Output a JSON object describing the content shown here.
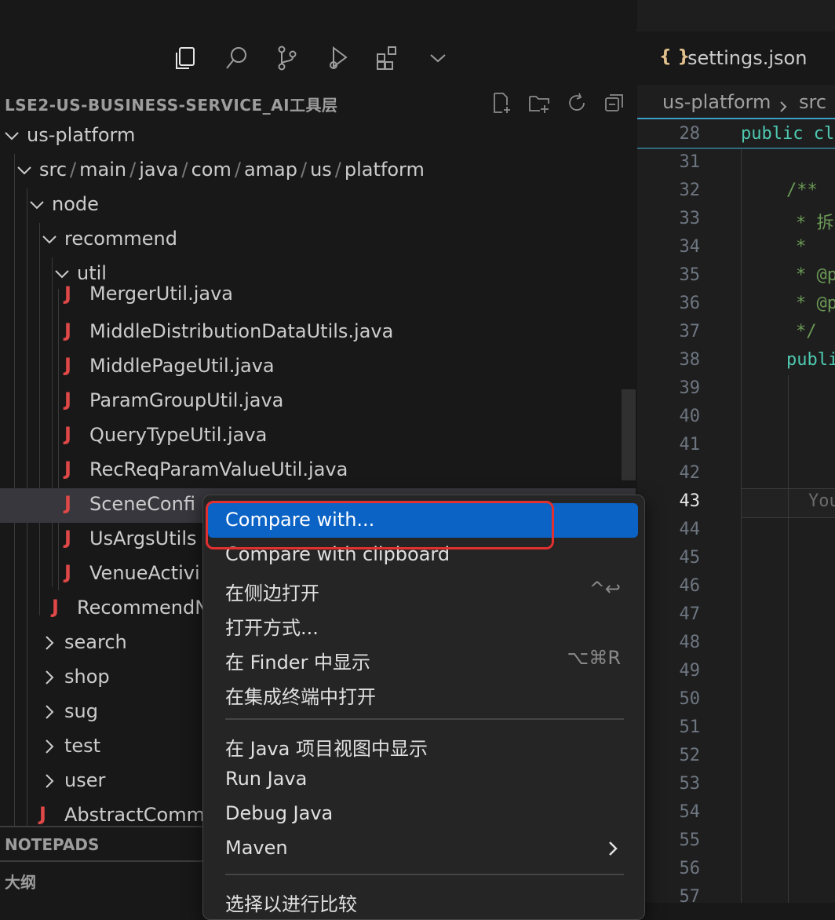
{
  "explorer": {
    "title": "LSE2-US-BUSINESS-SERVICE_AI工具层",
    "tree": {
      "root": "us-platform",
      "package_path": [
        "src",
        "main",
        "java",
        "com",
        "amap",
        "us",
        "platform"
      ],
      "node": "node",
      "recommend": "recommend",
      "util": "util",
      "util_files": [
        "MergerUtil.java",
        "MiddleDistributionDataUtils.java",
        "MiddlePageUtil.java",
        "ParamGroupUtil.java",
        "QueryTypeUtil.java",
        "RecReqParamValueUtil.java",
        "SceneConfi",
        "UsArgsUtils",
        "VenueActivi"
      ],
      "recommend_file": "RecommendN",
      "folders": [
        "search",
        "shop",
        "sug",
        "test",
        "user"
      ],
      "last_file": "AbstractComm",
      "java_icon": "J"
    },
    "sections": {
      "notepads": "NOTEPADS",
      "outline": "大纲"
    }
  },
  "editor": {
    "tab": {
      "icon": "{ }",
      "label": "settings.json"
    },
    "breadcrumbs": [
      "us-platform",
      "src"
    ],
    "lines": [
      {
        "num": "28",
        "text": "public cl"
      },
      {
        "num": "31",
        "text": ""
      },
      {
        "num": "32",
        "text": "/**"
      },
      {
        "num": "33",
        "text": "* 拆"
      },
      {
        "num": "34",
        "text": "*"
      },
      {
        "num": "35",
        "text": "* @p"
      },
      {
        "num": "36",
        "text": "* @p"
      },
      {
        "num": "37",
        "text": "*/"
      },
      {
        "num": "38",
        "text": "publi"
      },
      {
        "num": "39",
        "text": ""
      },
      {
        "num": "40",
        "text": ""
      },
      {
        "num": "41",
        "text": ""
      },
      {
        "num": "42",
        "text": ""
      },
      {
        "num": "43",
        "text": "You"
      },
      {
        "num": "44",
        "text": ""
      },
      {
        "num": "45",
        "text": ""
      },
      {
        "num": "46",
        "text": ""
      },
      {
        "num": "47",
        "text": ""
      },
      {
        "num": "48",
        "text": ""
      },
      {
        "num": "49",
        "text": ""
      },
      {
        "num": "50",
        "text": ""
      },
      {
        "num": "51",
        "text": ""
      },
      {
        "num": "52",
        "text": ""
      },
      {
        "num": "53",
        "text": ""
      },
      {
        "num": "54",
        "text": ""
      },
      {
        "num": "55",
        "text": ""
      },
      {
        "num": "56",
        "text": ""
      },
      {
        "num": "57",
        "text": ""
      }
    ]
  },
  "context_menu": {
    "items": [
      {
        "label": "Compare with...",
        "shortcut": ""
      },
      {
        "label": "Compare with clipboard",
        "shortcut": ""
      },
      {
        "label": "在侧边打开",
        "shortcut": "^↩"
      },
      {
        "label": "打开方式...",
        "shortcut": ""
      },
      {
        "label": "在 Finder 中显示",
        "shortcut": "⌥⌘R"
      },
      {
        "label": "在集成终端中打开",
        "shortcut": ""
      },
      {
        "label": "在 Java 项目视图中显示",
        "shortcut": ""
      },
      {
        "label": "Run Java",
        "shortcut": ""
      },
      {
        "label": "Debug Java",
        "shortcut": ""
      },
      {
        "label": "Maven",
        "shortcut": ""
      },
      {
        "label": "选择以进行比较",
        "shortcut": ""
      }
    ]
  },
  "colors": {
    "menu_highlight": "#0b63c6",
    "annotation": "#e03030",
    "java_icon": "#e04848",
    "json_icon": "#e2c08d"
  }
}
